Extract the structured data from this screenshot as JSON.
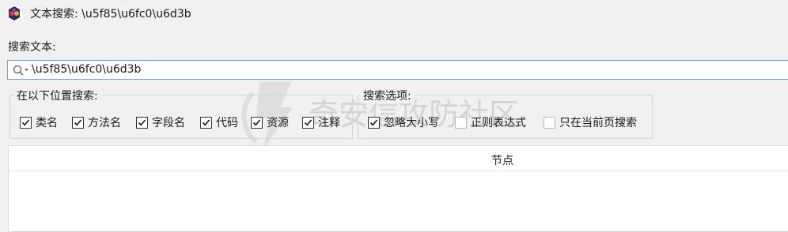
{
  "window": {
    "title": "文本搜索: \\u5f85\\u6fc0\\u6d3b"
  },
  "search": {
    "label": "搜索文本:",
    "value": "\\u5f85\\u6fc0\\u6d3b"
  },
  "location_group": {
    "legend": "在以下位置搜索:",
    "items": [
      {
        "label": "类名",
        "checked": true
      },
      {
        "label": "方法名",
        "checked": true
      },
      {
        "label": "字段名",
        "checked": true
      },
      {
        "label": "代码",
        "checked": true
      },
      {
        "label": "资源",
        "checked": true
      },
      {
        "label": "注释",
        "checked": true
      }
    ]
  },
  "options_group": {
    "legend": "搜索选项:",
    "items": [
      {
        "label": "忽略大小写",
        "checked": true
      },
      {
        "label": "正则表达式",
        "checked": false
      },
      {
        "label": "只在当前页搜索",
        "checked": false
      }
    ]
  },
  "results_table": {
    "columns": [
      "节点"
    ],
    "rows": []
  },
  "watermark": {
    "text": "奇安信攻防社区"
  },
  "colors": {
    "focus_border": "#7a9fcf",
    "window_bg": "#f0f0f0",
    "watermark": "#c9c9c9"
  }
}
